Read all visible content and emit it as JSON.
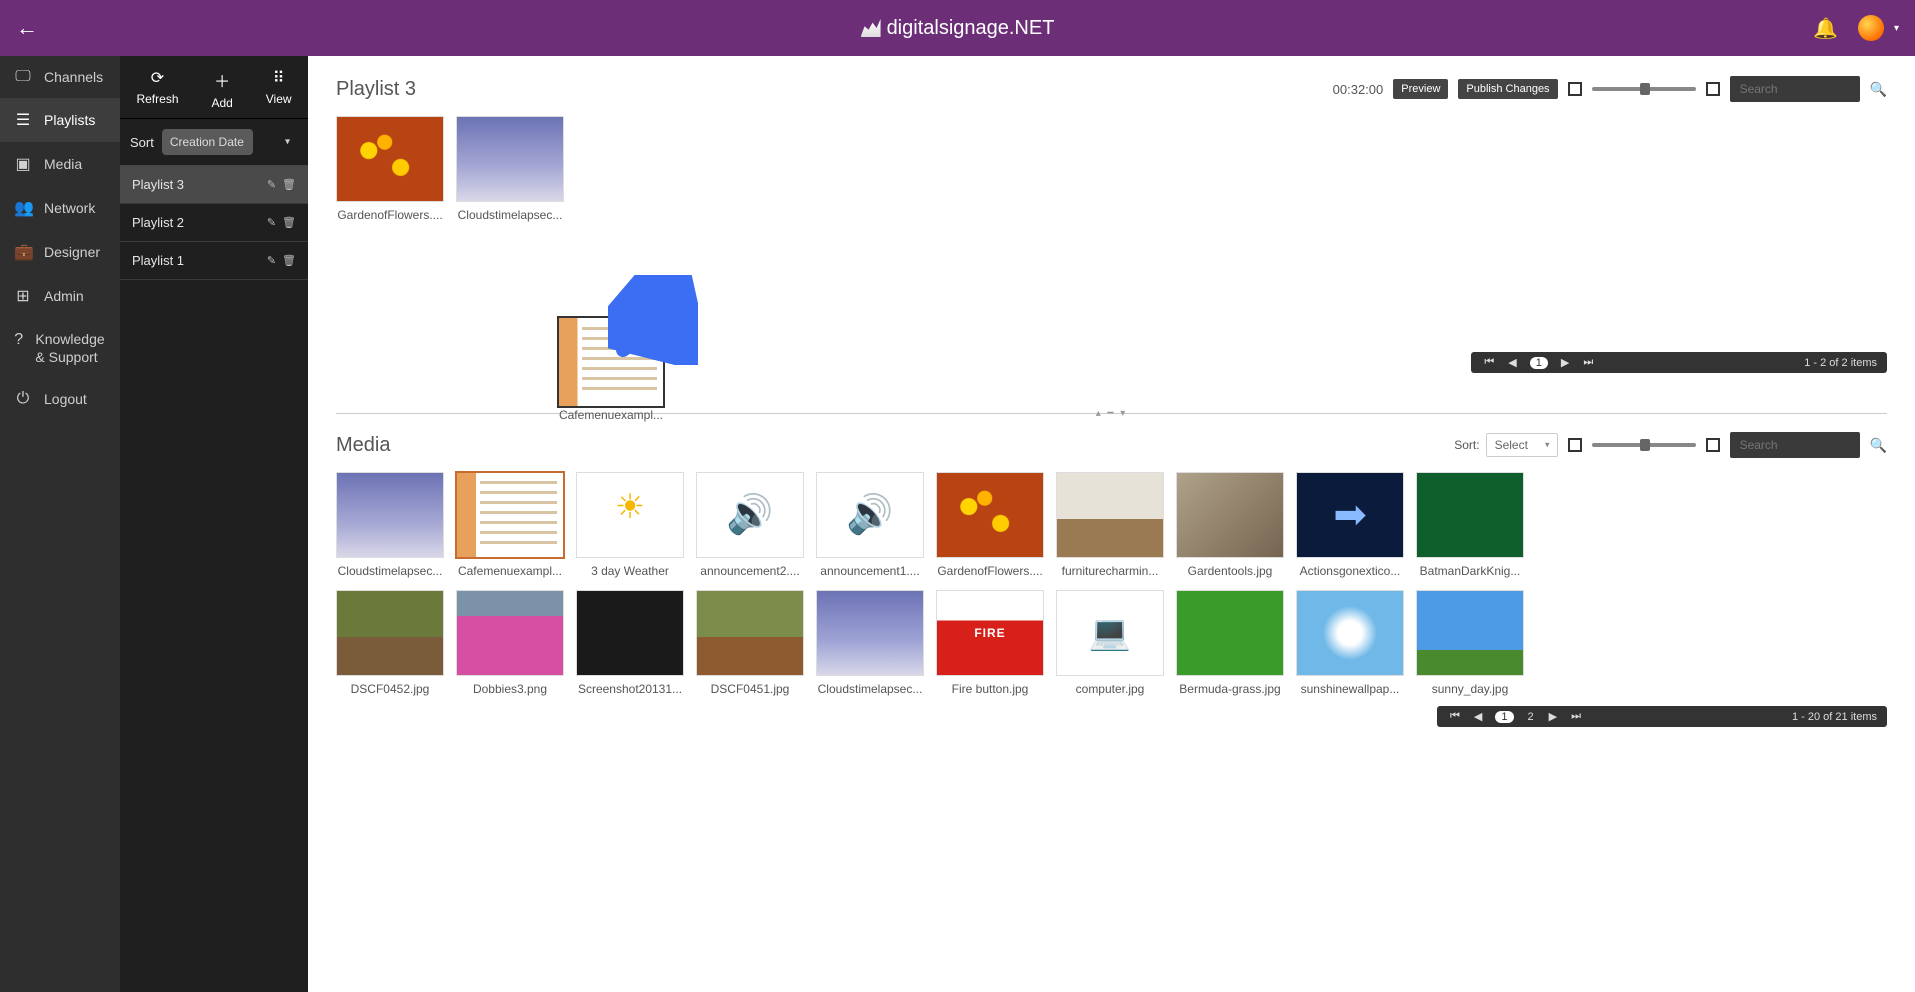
{
  "brand": {
    "name": "digitalsignage.NET"
  },
  "nav": {
    "channels": "Channels",
    "playlists": "Playlists",
    "media": "Media",
    "network": "Network",
    "designer": "Designer",
    "admin": "Admin",
    "knowledge_support": "Knowledge & Support",
    "logout": "Logout"
  },
  "panel2": {
    "refresh": "Refresh",
    "add": "Add",
    "view": "View",
    "sort_label": "Sort",
    "sort_value": "Creation Date",
    "playlists": [
      {
        "name": "Playlist 3"
      },
      {
        "name": "Playlist 2"
      },
      {
        "name": "Playlist 1"
      }
    ]
  },
  "playlist_section": {
    "title": "Playlist 3",
    "duration": "00:32:00",
    "preview": "Preview",
    "publish": "Publish Changes",
    "search_placeholder": "Search",
    "items": [
      {
        "label": "GardenofFlowers....",
        "bg": "bg-flowers"
      },
      {
        "label": "Cloudstimelapsec...",
        "bg": "bg-clouds"
      }
    ],
    "pager": {
      "page": "1",
      "info": "1 - 2 of 2 items"
    }
  },
  "drag_ghost": {
    "label": "Cafemenuexampl..."
  },
  "media_section": {
    "title": "Media",
    "sort_label": "Sort:",
    "sort_value": "Select",
    "search_placeholder": "Search",
    "items_row1": [
      {
        "label": "Cloudstimelapsec...",
        "bg": "bg-clouds"
      },
      {
        "label": "Cafemenuexampl...",
        "bg": "bg-menu",
        "selected": true
      },
      {
        "label": "3 day Weather",
        "bg": "bg-weather"
      },
      {
        "label": "announcement2....",
        "bg": "bg-audio"
      },
      {
        "label": "announcement1....",
        "bg": "bg-audio"
      },
      {
        "label": "GardenofFlowers....",
        "bg": "bg-flowers"
      },
      {
        "label": "furniturecharmin...",
        "bg": "bg-furniture"
      },
      {
        "label": "Gardentools.jpg",
        "bg": "bg-tools"
      },
      {
        "label": "Actionsgonextico...",
        "bg": "bg-arrow"
      },
      {
        "label": "BatmanDarkKnig...",
        "bg": "bg-batman"
      }
    ],
    "items_row2": [
      {
        "label": "DSCF0452.jpg",
        "bg": "bg-forest"
      },
      {
        "label": "Dobbies3.png",
        "bg": "bg-dobbies"
      },
      {
        "label": "Screenshot20131...",
        "bg": "bg-screenshot"
      },
      {
        "label": "DSCF0451.jpg",
        "bg": "bg-forest2"
      },
      {
        "label": "Cloudstimelapsec...",
        "bg": "bg-clouds2"
      },
      {
        "label": "Fire button.jpg",
        "bg": "bg-fire"
      },
      {
        "label": "computer.jpg",
        "bg": "bg-computer"
      },
      {
        "label": "Bermuda-grass.jpg",
        "bg": "bg-grass"
      },
      {
        "label": "sunshinewallpap...",
        "bg": "bg-sunshine"
      },
      {
        "label": "sunny_day.jpg",
        "bg": "bg-sunny"
      }
    ],
    "pager": {
      "page1": "1",
      "page2": "2",
      "info": "1 - 20 of 21 items"
    }
  }
}
